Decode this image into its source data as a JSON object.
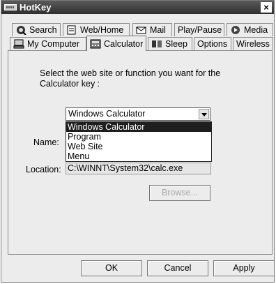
{
  "window": {
    "title": "HotKey",
    "close_label": "×"
  },
  "tabs_top": [
    "Search",
    "Web/Home",
    "Mail",
    "Play/Pause",
    "Media"
  ],
  "tabs_bottom": [
    "My Computer",
    "Calculator",
    "Sleep",
    "Options",
    "Wireless"
  ],
  "active_tab": "Calculator",
  "panel": {
    "prompt": "Select the web site or function you want for the Calculator key :",
    "function_select": {
      "value": "Windows Calculator",
      "options": [
        "Windows Calculator",
        "Program",
        "Web Site",
        "Menu"
      ],
      "highlighted": "Windows Calculator"
    },
    "name_label": "Name:",
    "location_label": "Location:",
    "location_value": "C:\\WINNT\\System32\\calc.exe",
    "browse_label": "Browse..."
  },
  "buttons": {
    "ok": "OK",
    "cancel": "Cancel",
    "apply": "Apply"
  },
  "icons": {
    "search": "globe-magnifier-icon",
    "web_home": "web-page-icon",
    "mail": "envelope-icon",
    "media": "media-player-icon",
    "my_computer": "computer-icon",
    "calculator": "calculator-icon",
    "sleep": "sleep-icon"
  }
}
